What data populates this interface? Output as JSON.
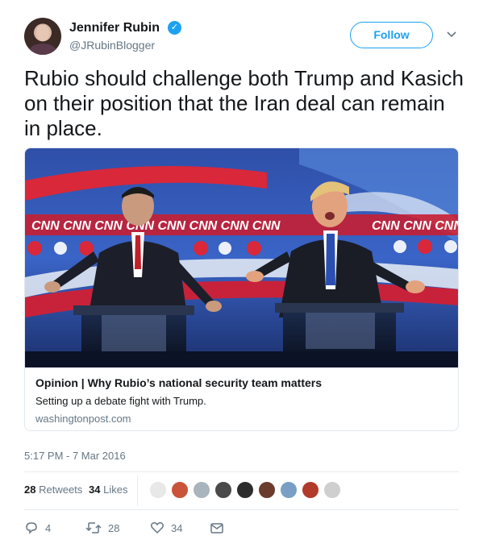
{
  "author": {
    "name": "Jennifer Rubin",
    "handle": "@JRubinBlogger",
    "verified_icon": "verified-badge-icon"
  },
  "follow_label": "Follow",
  "tweet_text": "Rubio should challenge both Trump and Kasich on their position that the Iran deal can remain in place.",
  "card": {
    "banner_text": "CNN CNN CNN CNN CNN CNN CNN CNN",
    "banner_text_right": "CNN CNN CNN",
    "title": "Opinion | Why Rubio’s national security team matters",
    "description": "Setting up a debate fight with Trump.",
    "domain": "washingtonpost.com"
  },
  "timestamp": "5:17 PM - 7 Mar 2016",
  "stats": {
    "retweets_count": "28",
    "retweets_label": "Retweets",
    "likes_count": "34",
    "likes_label": "Likes"
  },
  "liker_avatars": [
    "#e8e8e8",
    "#c9543a",
    "#aab4bd",
    "#4a4a4a",
    "#2d2d2d",
    "#6b3b2e",
    "#7a9fc4",
    "#b23a2a",
    "#cfcfcf"
  ],
  "actions": {
    "reply_count": "4",
    "retweet_count": "28",
    "like_count": "34"
  },
  "colors": {
    "accent": "#1da1f2",
    "muted": "#657786",
    "text": "#14171a"
  }
}
